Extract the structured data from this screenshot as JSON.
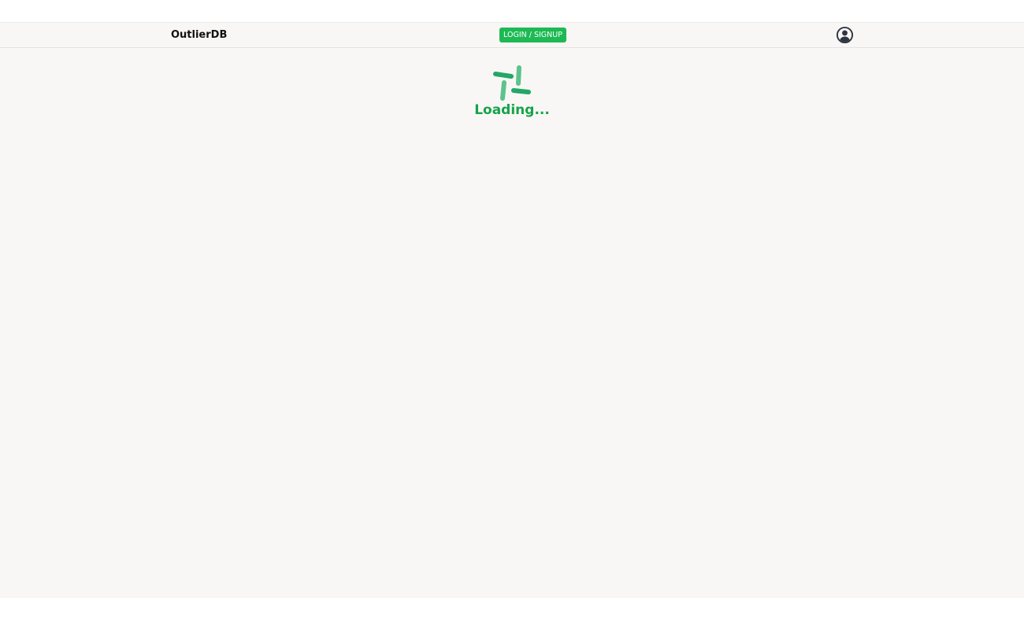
{
  "header": {
    "brand": "OutlierDB",
    "login_label": "LOGIN / SIGNUP",
    "profile_icon": "user-circle-icon"
  },
  "loader": {
    "icon": "spinner-icon",
    "text": "Loading..."
  },
  "colors": {
    "accent": "#1db954",
    "loading_text": "#16a34a",
    "spinner_dark": "#21a866",
    "spinner_light": "#5cc38c",
    "avatar": "#2f3542",
    "background": "#f8f7f5"
  }
}
